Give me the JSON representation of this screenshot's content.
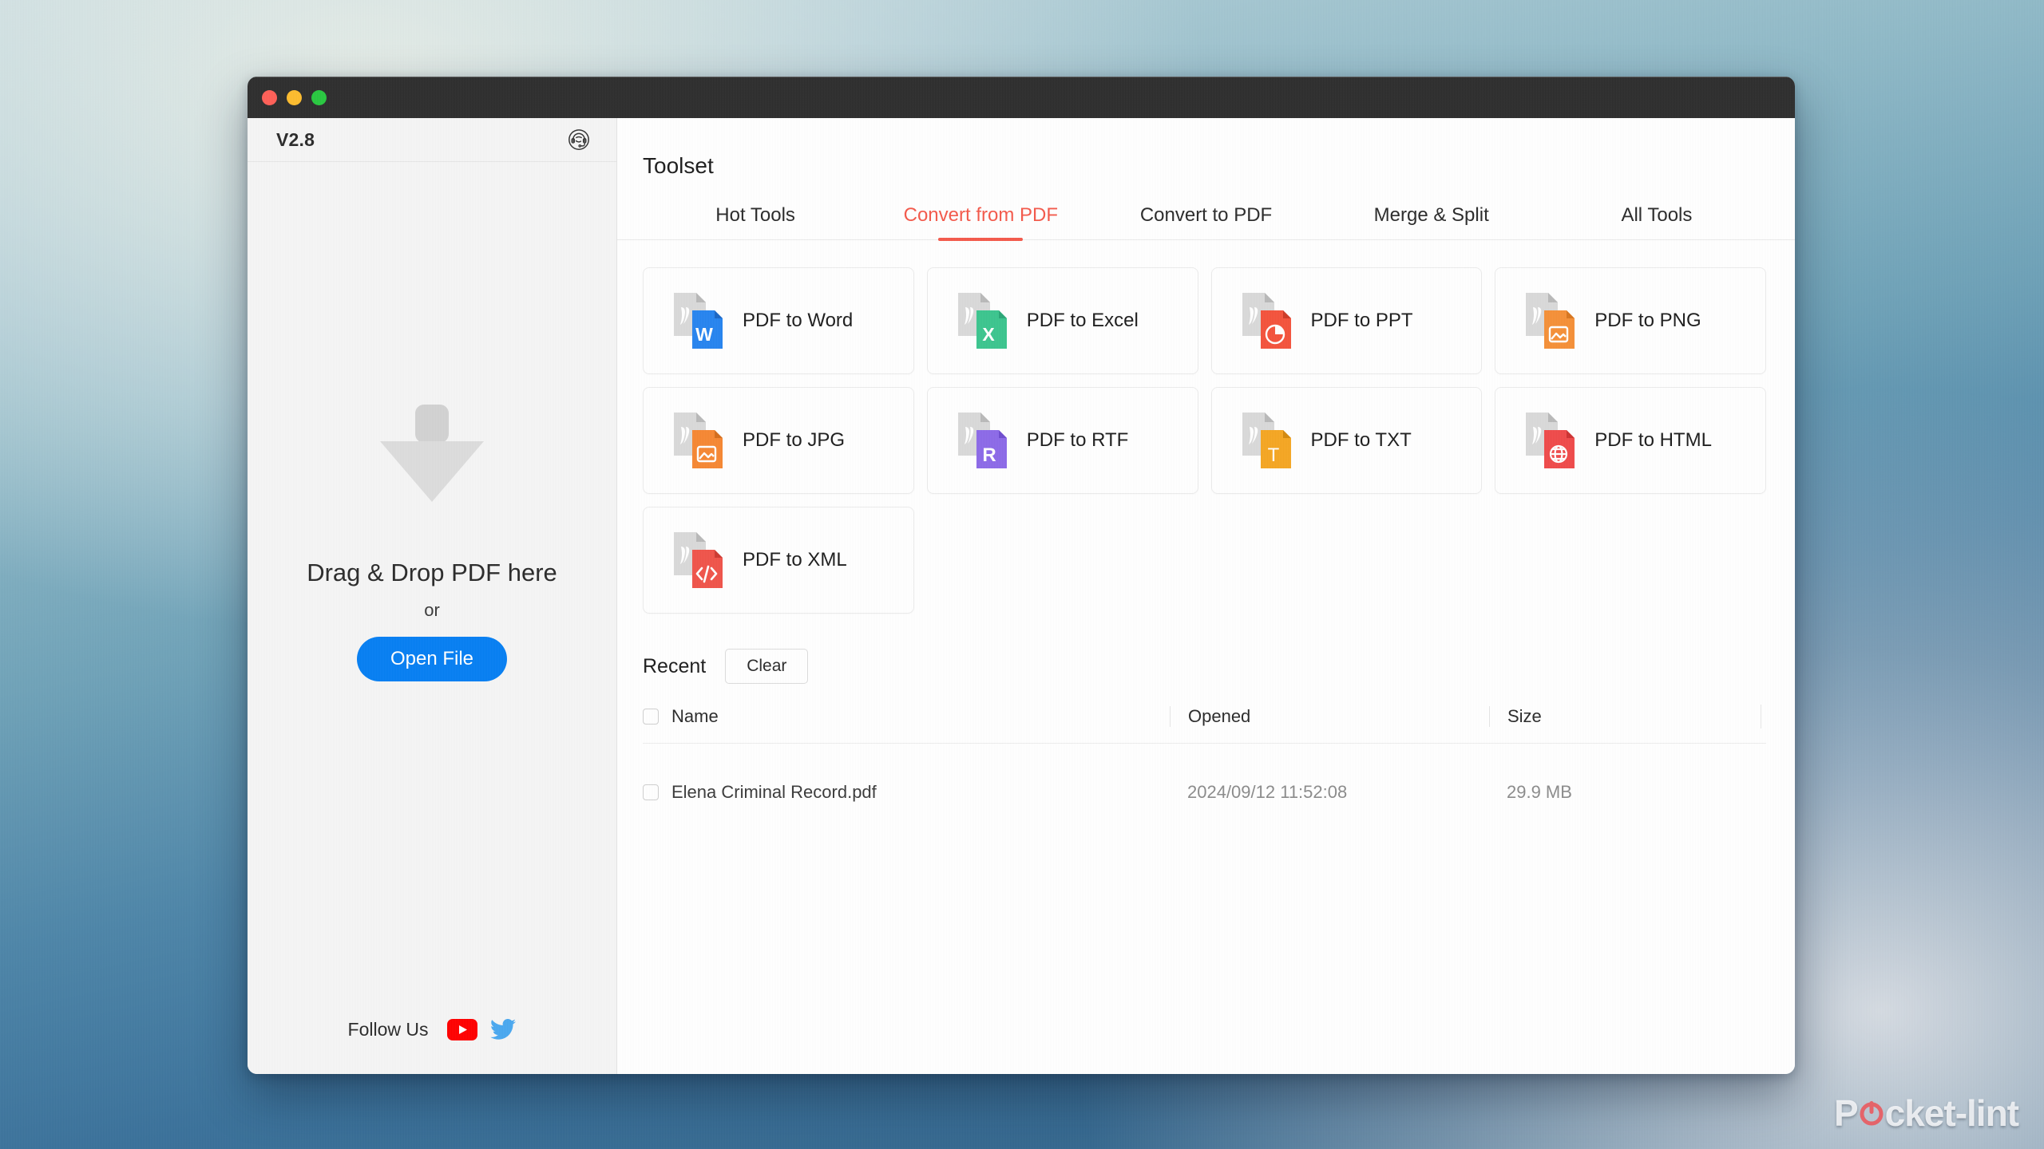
{
  "window": {
    "traffic_lights": [
      "close-red",
      "minimize-yellow",
      "maximize-green"
    ]
  },
  "sidebar": {
    "version": "V2.8",
    "support_icon": "headset-support-icon",
    "dropzone": {
      "arrow_icon": "download-arrow-icon",
      "title": "Drag & Drop PDF here",
      "or": "or",
      "open_file_label": "Open File"
    },
    "follow": {
      "label": "Follow Us",
      "youtube_icon": "youtube-icon",
      "twitter_icon": "twitter-icon"
    }
  },
  "main": {
    "title": "Toolset",
    "tabs": [
      {
        "label": "Hot Tools",
        "active": false
      },
      {
        "label": "Convert from PDF",
        "active": true
      },
      {
        "label": "Convert to PDF",
        "active": false
      },
      {
        "label": "Merge & Split",
        "active": false
      },
      {
        "label": "All Tools",
        "active": false
      }
    ],
    "tools": [
      {
        "label": "PDF to Word",
        "icon": "word-file-icon",
        "color": "#2684ef",
        "glyph": "W"
      },
      {
        "label": "PDF to Excel",
        "icon": "excel-file-icon",
        "color": "#3cc58e",
        "glyph": "X"
      },
      {
        "label": "PDF to PPT",
        "icon": "ppt-file-icon",
        "color": "#f4533c",
        "glyph": "pie"
      },
      {
        "label": "PDF to PNG",
        "icon": "png-file-icon",
        "color": "#f59038",
        "glyph": "image"
      },
      {
        "label": "PDF to JPG",
        "icon": "jpg-file-icon",
        "color": "#f68733",
        "glyph": "image"
      },
      {
        "label": "PDF to RTF",
        "icon": "rtf-file-icon",
        "color": "#8c6ae8",
        "glyph": "R"
      },
      {
        "label": "PDF to TXT",
        "icon": "txt-file-icon",
        "color": "#f5a623",
        "glyph": "T"
      },
      {
        "label": "PDF to HTML",
        "icon": "html-file-icon",
        "color": "#ef4a4a",
        "glyph": "globe"
      },
      {
        "label": "PDF to XML",
        "icon": "xml-file-icon",
        "color": "#f0544a",
        "glyph": "code"
      }
    ],
    "recent": {
      "title": "Recent",
      "clear_label": "Clear",
      "columns": [
        "Name",
        "Opened",
        "Size"
      ],
      "rows": [
        {
          "name": "Elena Criminal Record.pdf",
          "opened": "2024/09/12 11:52:08",
          "size": "29.9 MB"
        }
      ]
    }
  },
  "watermark": {
    "prefix": "P",
    "suffix": "cket-lint"
  },
  "colors": {
    "accent_red": "#f4594b",
    "primary_blue": "#067ff3",
    "titlebar": "#2e2e2e",
    "sidebar_bg": "#f5f5f5"
  }
}
